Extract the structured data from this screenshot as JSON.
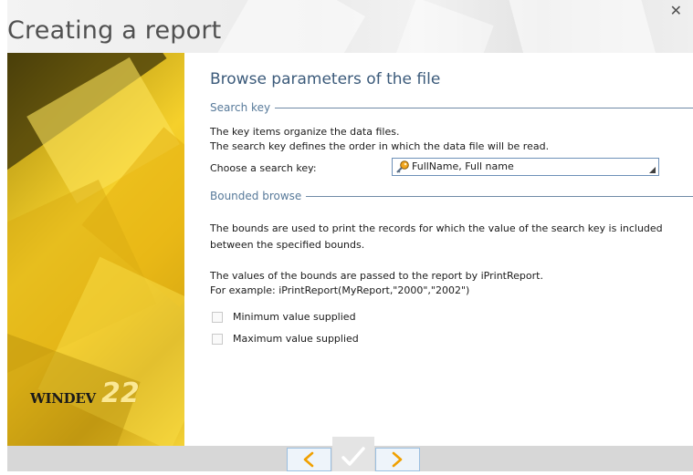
{
  "window": {
    "title": "Creating a report",
    "close_icon": "close-icon"
  },
  "branding": {
    "logo_text": "WINDEV",
    "logo_version": "22"
  },
  "main": {
    "heading": "Browse parameters of the file",
    "search_key": {
      "section_label": "Search key",
      "line1": "The key items organize the data files.",
      "line2": "The search key defines the order in which the data file will be read.",
      "choose_label": "Choose a search key:",
      "selected_value": "FullName, Full name",
      "selected_icon": "key-icon"
    },
    "bounded": {
      "section_label": "Bounded browse",
      "para1_line1": "The bounds are used to print the records for which the value of the search key is included",
      "para1_line2": "between the specified bounds.",
      "para2_line1": "The values of the bounds are passed to the report by iPrintReport.",
      "para2_line2": "For example: iPrintReport(MyReport,\"2000\",\"2002\")",
      "min_label": "Minimum value supplied",
      "max_label": "Maximum value supplied",
      "min_checked": false,
      "max_checked": false
    }
  },
  "footer": {
    "prev_icon": "chevron-left-icon",
    "ok_icon": "check-icon",
    "next_icon": "chevron-right-icon"
  },
  "colors": {
    "accent": "#3b5a7a",
    "brand_yellow": "#f5d02b",
    "nav_border": "#9bbfe0"
  }
}
